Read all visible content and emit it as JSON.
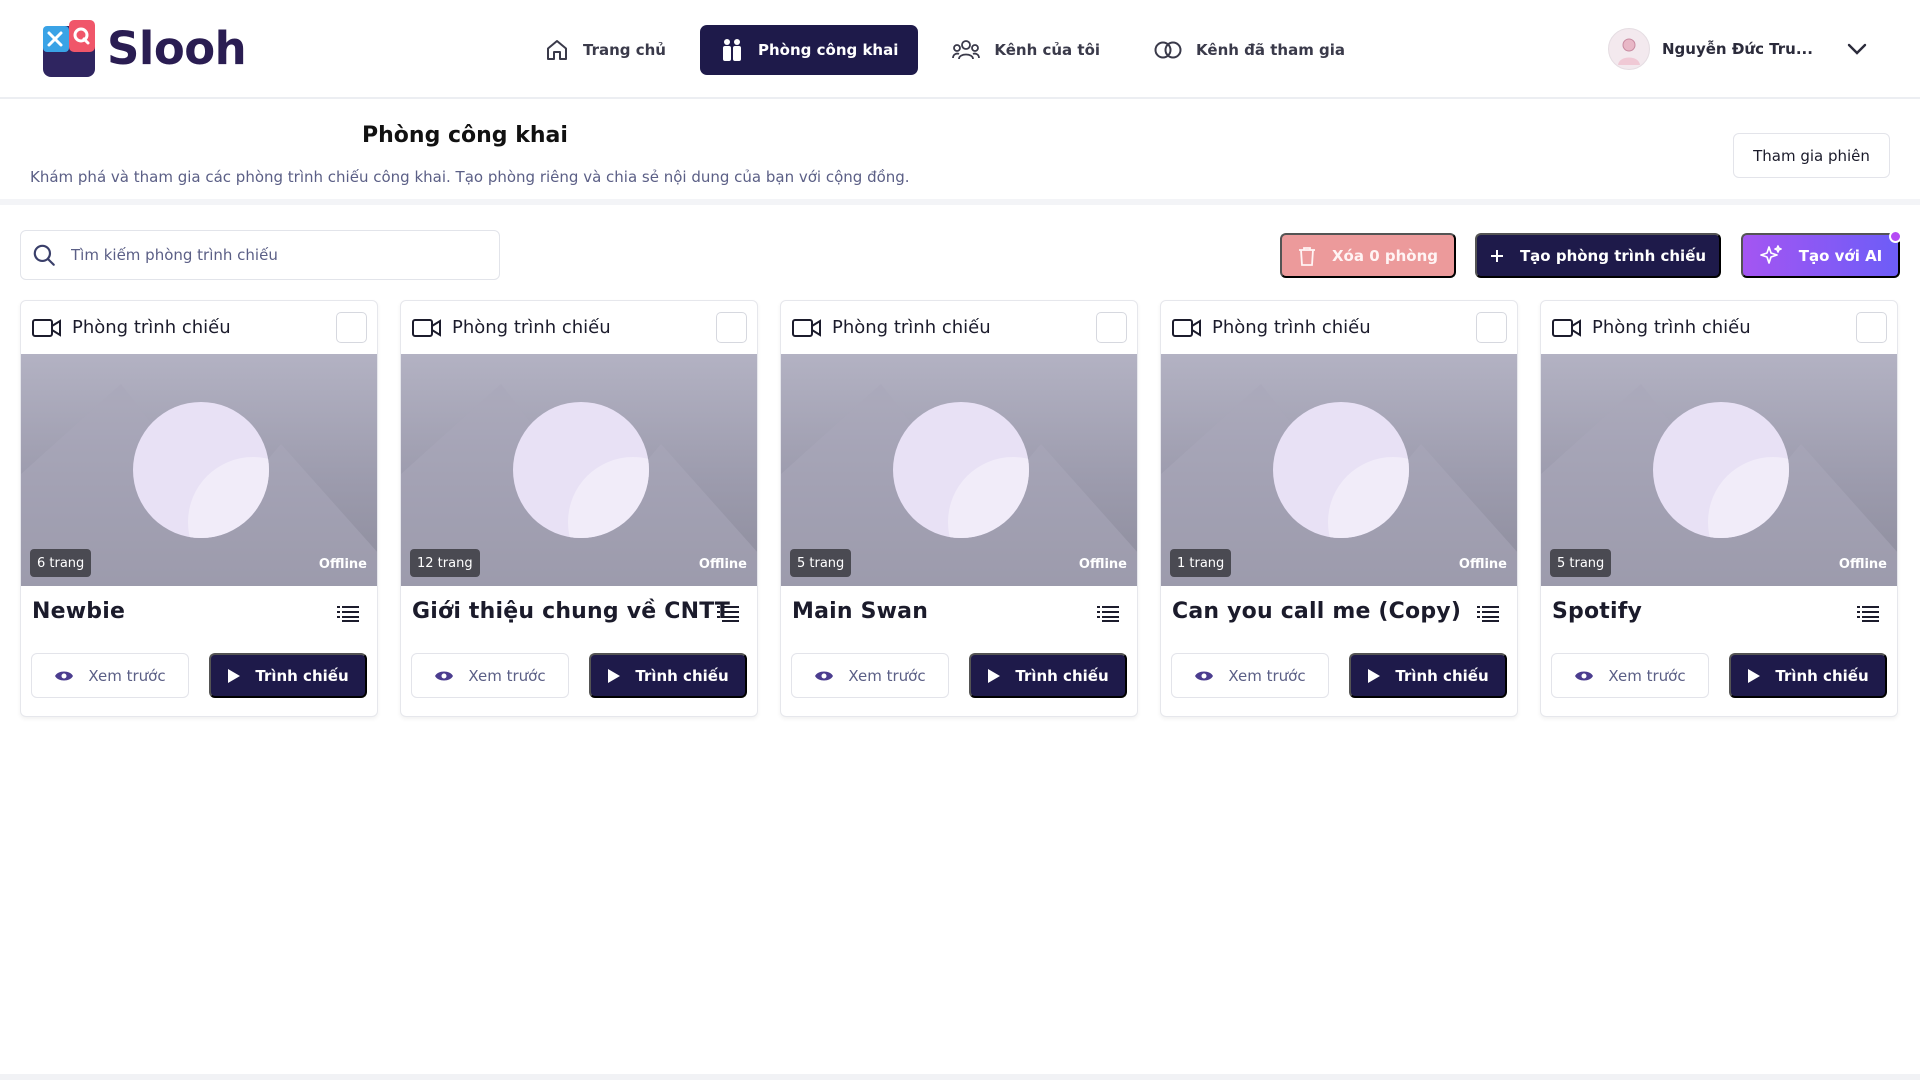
{
  "app": {
    "name": "Slooh"
  },
  "nav": [
    {
      "label": "Trang chủ",
      "icon": "home-icon",
      "active": false
    },
    {
      "label": "Phòng công khai",
      "icon": "people-icon",
      "active": true
    },
    {
      "label": "Kênh của tôi",
      "icon": "users-group-icon",
      "active": false
    },
    {
      "label": "Kênh đã tham gia",
      "icon": "linked-rings-icon",
      "active": false
    }
  ],
  "user": {
    "name": "Nguyễn Đức Tru..."
  },
  "header": {
    "title": "Phòng công khai",
    "description": "Khám phá và tham gia các phòng trình chiếu công khai. Tạo phòng riêng và chia sẻ nội dung của bạn với cộng đồng.",
    "join_label": "Tham gia phiên"
  },
  "toolbar": {
    "search_placeholder": "Tìm kiếm phòng trình chiếu",
    "delete_label": "Xóa 0 phòng",
    "create_label": "Tạo phòng trình chiếu",
    "ai_label": "Tạo với AI"
  },
  "cards": [
    {
      "type": "Phòng trình chiếu",
      "title": "Newbie",
      "pages": "6 trang",
      "status": "Offline",
      "preview": "Xem trước",
      "present": "Trình chiếu"
    },
    {
      "type": "Phòng trình chiếu",
      "title": "Giới thiệu chung về CNTT",
      "pages": "12 trang",
      "status": "Offline",
      "preview": "Xem trước",
      "present": "Trình chiếu"
    },
    {
      "type": "Phòng trình chiếu",
      "title": "Main Swan",
      "pages": "5 trang",
      "status": "Offline",
      "preview": "Xem trước",
      "present": "Trình chiếu"
    },
    {
      "type": "Phòng trình chiếu",
      "title": "Can you call me (Copy)",
      "pages": "1 trang",
      "status": "Offline",
      "preview": "Xem trước",
      "present": "Trình chiếu"
    },
    {
      "type": "Phòng trình chiếu",
      "title": "Spotify",
      "pages": "5 trang",
      "status": "Offline",
      "preview": "Xem trước",
      "present": "Trình chiếu"
    }
  ],
  "colors": {
    "primary": "#1e1a4a",
    "delete": "#ec9a9b",
    "ai_gradient_start": "#a455f2",
    "ai_gradient_end": "#6d5df7"
  }
}
